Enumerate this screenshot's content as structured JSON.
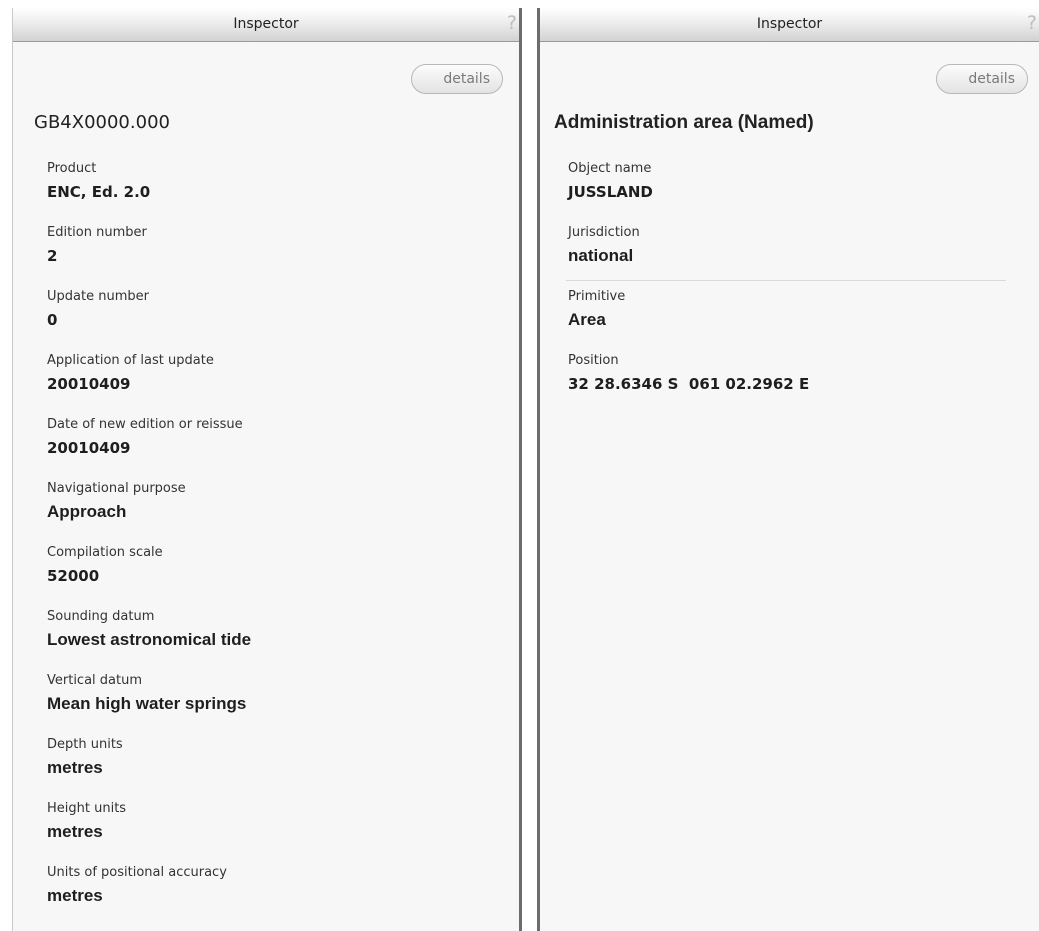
{
  "left_panel": {
    "title": "Inspector",
    "help_icon": "?",
    "details_label": "details",
    "heading": "GB4X0000.000",
    "properties": [
      {
        "label": "Product",
        "value": "ENC, Ed. 2.0"
      },
      {
        "label": "Edition number",
        "value": "2"
      },
      {
        "label": "Update number",
        "value": "0"
      },
      {
        "label": "Application of last update",
        "value": "20010409"
      },
      {
        "label": "Date of new edition or reissue",
        "value": "20010409"
      },
      {
        "label": "Navigational purpose",
        "value": "Approach"
      },
      {
        "label": "Compilation scale",
        "value": "52000"
      },
      {
        "label": "Sounding datum",
        "value": "Lowest astronomical tide"
      },
      {
        "label": "Vertical datum",
        "value": "Mean high water springs"
      },
      {
        "label": "Depth units",
        "value": "metres"
      },
      {
        "label": "Height units",
        "value": "metres"
      },
      {
        "label": "Units of positional accuracy",
        "value": "metres"
      }
    ]
  },
  "right_panel": {
    "title": "Inspector",
    "help_icon": "?",
    "details_label": "details",
    "heading": "Administration area (Named)",
    "properties": [
      {
        "label": "Object name",
        "value": "JUSSLAND"
      },
      {
        "label": "Jurisdiction",
        "value": "national"
      },
      {
        "label": "Primitive",
        "value": "Area"
      },
      {
        "label": "Position",
        "value": "32 28.6346 S  061 02.2962 E"
      }
    ]
  }
}
